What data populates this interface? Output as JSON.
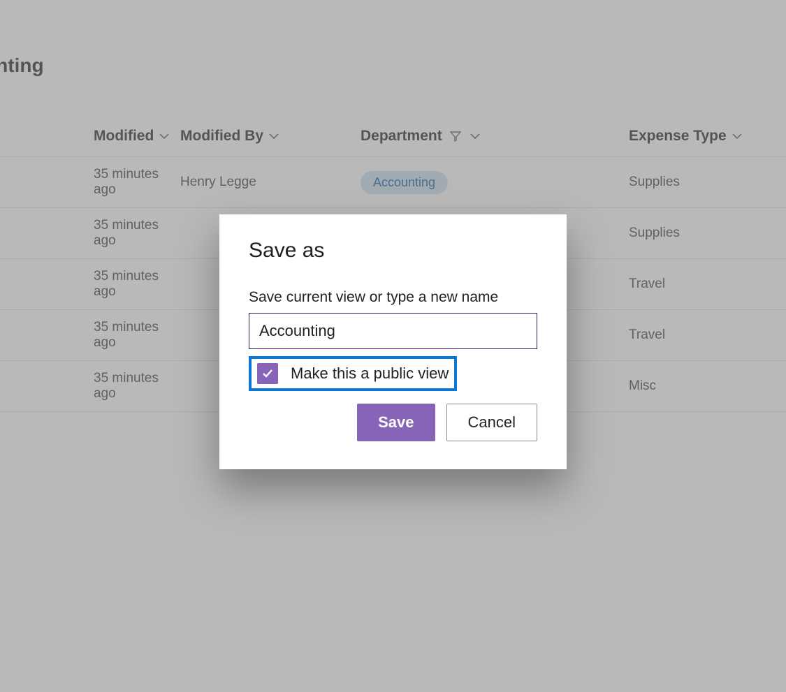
{
  "page": {
    "title": "ounting"
  },
  "table": {
    "headers": {
      "modified": "Modified",
      "modified_by": "Modified By",
      "department": "Department",
      "expense_type": "Expense Type"
    },
    "rows": [
      {
        "modified": "35 minutes ago",
        "modified_by": "Henry Legge",
        "department": "Accounting",
        "expense_type": "Supplies"
      },
      {
        "modified": "35 minutes ago",
        "modified_by": "",
        "department": "",
        "expense_type": "Supplies"
      },
      {
        "modified": "35 minutes ago",
        "modified_by": "",
        "department": "",
        "expense_type": "Travel"
      },
      {
        "modified": "35 minutes ago",
        "modified_by": "",
        "department": "",
        "expense_type": "Travel"
      },
      {
        "modified": "35 minutes ago",
        "modified_by": "",
        "department": "",
        "expense_type": "Misc"
      }
    ]
  },
  "dialog": {
    "title": "Save as",
    "label": "Save current view or type a new name",
    "input_value": "Accounting",
    "checkbox_label": "Make this a public view",
    "checkbox_checked": true,
    "save": "Save",
    "cancel": "Cancel"
  }
}
